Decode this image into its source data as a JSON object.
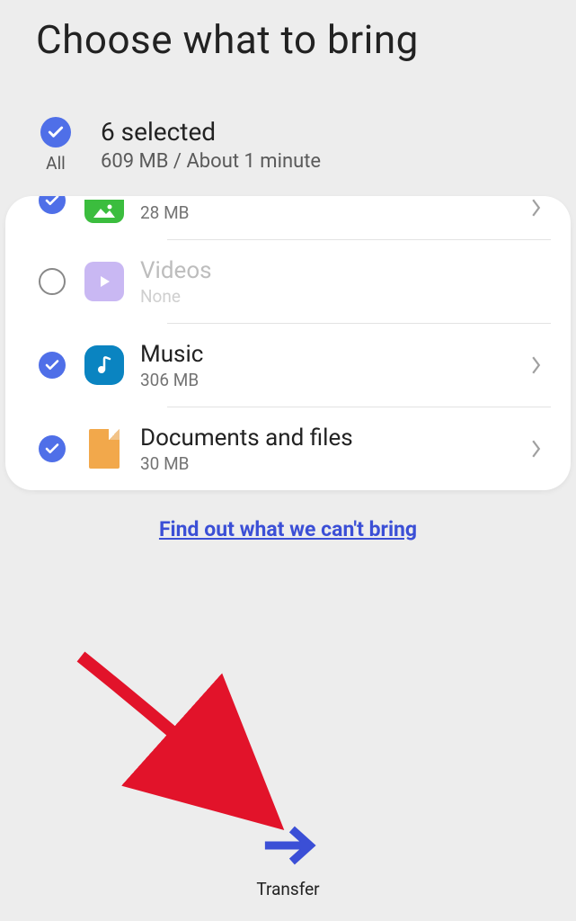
{
  "header": {
    "title": "Choose what to bring"
  },
  "summary": {
    "all_label": "All",
    "selected": "6 selected",
    "detail": "609 MB / About 1 minute"
  },
  "items": [
    {
      "title": "",
      "sub": "28 MB",
      "checked": true,
      "enabled": true,
      "icon": "image",
      "chevron": true
    },
    {
      "title": "Videos",
      "sub": "None",
      "checked": false,
      "enabled": false,
      "icon": "video",
      "chevron": false
    },
    {
      "title": "Music",
      "sub": "306 MB",
      "checked": true,
      "enabled": true,
      "icon": "music",
      "chevron": true
    },
    {
      "title": "Documents and files",
      "sub": "30 MB",
      "checked": true,
      "enabled": true,
      "icon": "doc",
      "chevron": true
    }
  ],
  "footer": {
    "link": "Find out what we can't bring",
    "transfer": "Transfer"
  },
  "colors": {
    "accent": "#4f6fe8",
    "link": "#3b4fd6"
  }
}
